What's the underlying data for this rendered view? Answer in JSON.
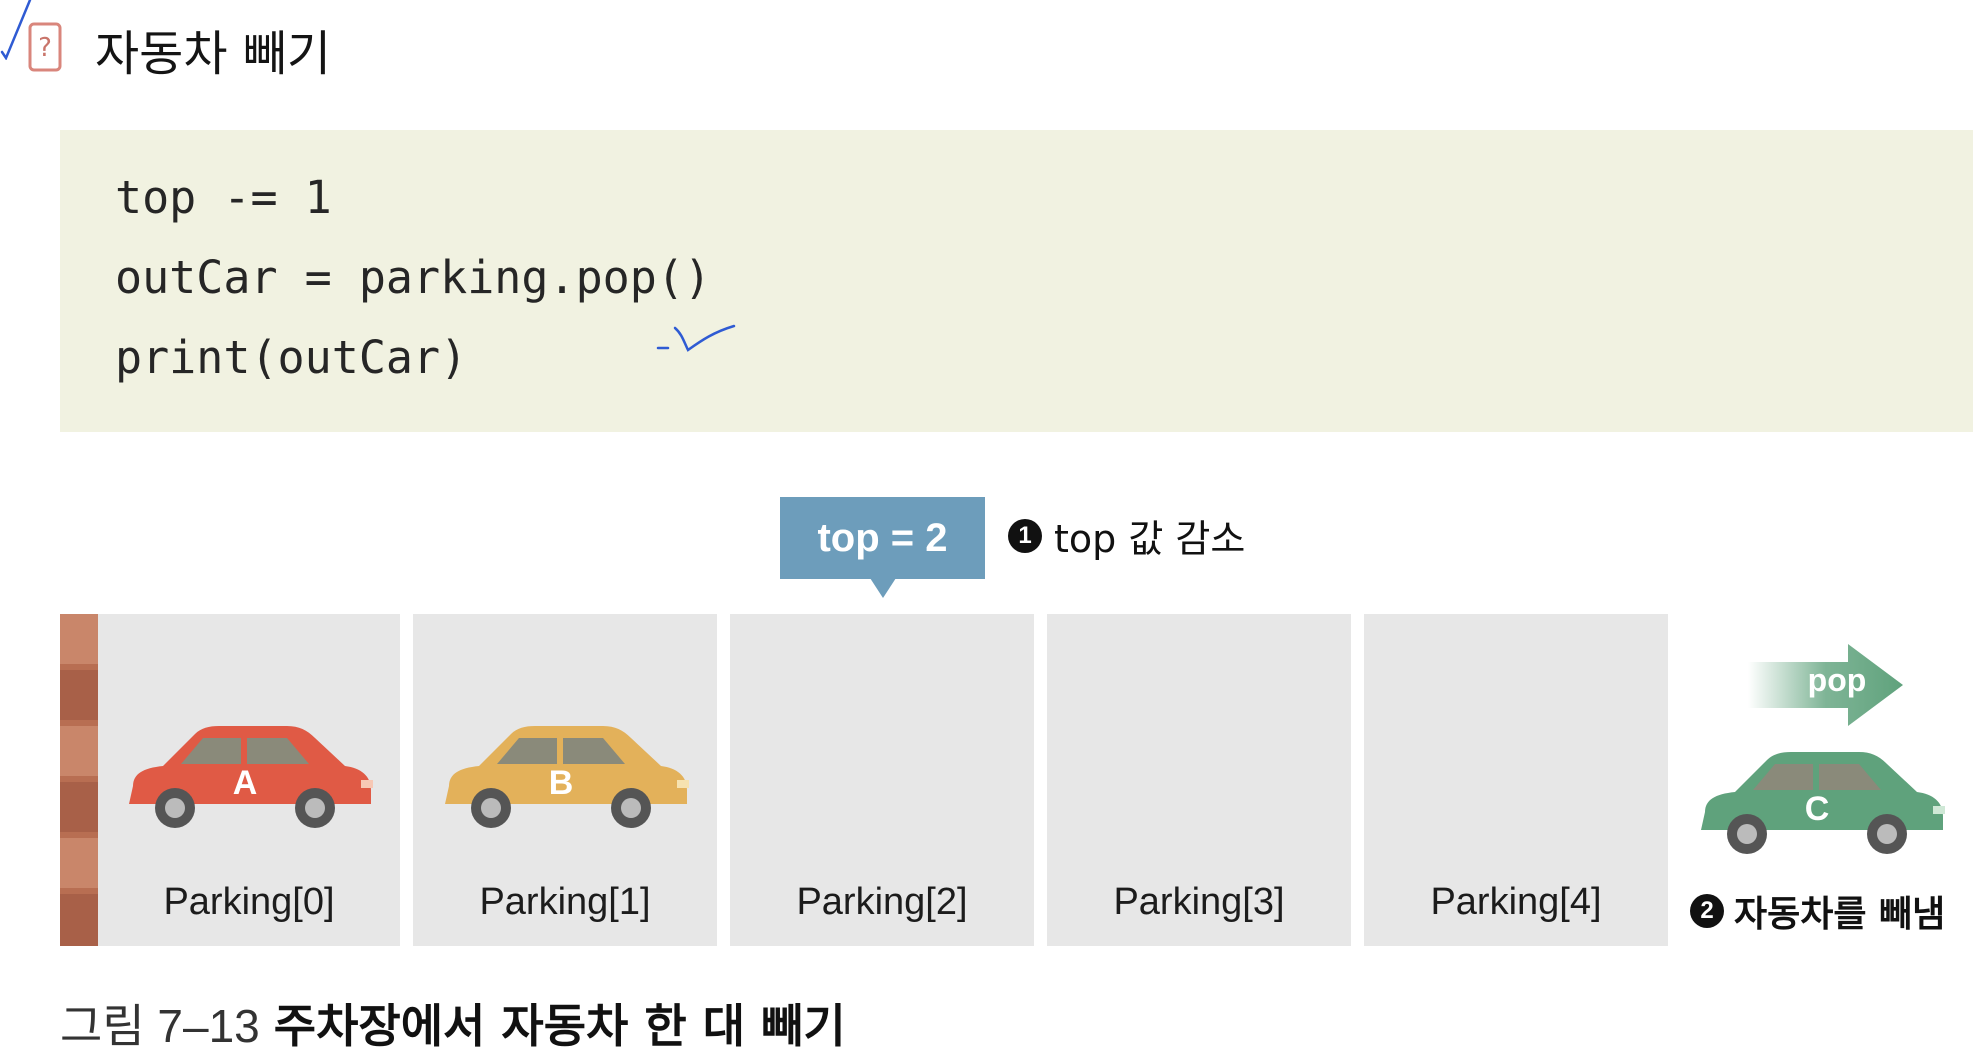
{
  "heading": {
    "icon": "question-card-icon",
    "title": "자동차 빼기"
  },
  "code": {
    "lines": [
      "top -= 1",
      "outCar = parking.pop()",
      "print(outCar)"
    ],
    "background": "#f1f2e1"
  },
  "diagram": {
    "top_box": {
      "label": "top = 2",
      "color": "#6d9dbb"
    },
    "step1": {
      "number": "1",
      "text": "top 값 감소"
    },
    "slots": [
      {
        "label": "Parking[0]",
        "car": "A",
        "car_color": "#e05a45"
      },
      {
        "label": "Parking[1]",
        "car": "B",
        "car_color": "#e3b15a"
      },
      {
        "label": "Parking[2]"
      },
      {
        "label": "Parking[3]"
      },
      {
        "label": "Parking[4]"
      }
    ],
    "pop": {
      "label": "pop",
      "car": "C",
      "car_color": "#5fa27c"
    },
    "step2": {
      "number": "2",
      "text": "자동차를 빼냄"
    }
  },
  "caption": {
    "number": "그림 7–13",
    "title": "주차장에서 자동차 한 대 빼기"
  },
  "colors": {
    "slot_bg": "#e7e7e7",
    "brick": "#b86e52",
    "pen_check": "#2f5bd3"
  }
}
